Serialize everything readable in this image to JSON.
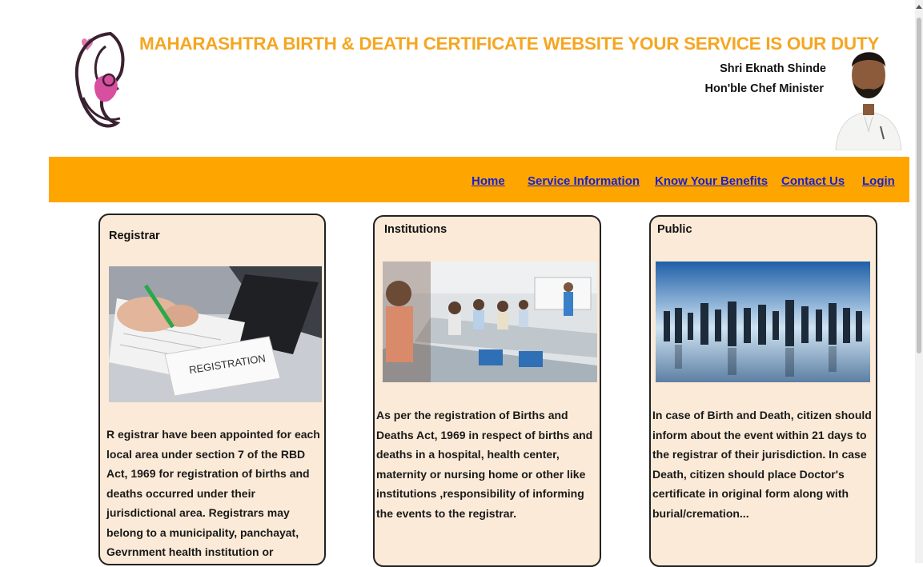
{
  "header": {
    "title": "MAHARASHTRA BIRTH & DEATH CERTIFICATE WEBSITE YOUR SERVICE IS OUR DUTY",
    "minister_name": "Shri Eknath Shinde",
    "minister_role": "Hon'ble Chef Minister",
    "logo_icon": "mother-and-child-logo",
    "photo_icon": "minister-portrait"
  },
  "nav": {
    "home": "Home",
    "service_information": "Service Information",
    "know_your_benefits": "Know Your Benefits",
    "contact_us": "Contact Us",
    "login": "Login"
  },
  "cards": {
    "registrar": {
      "title": "Registrar",
      "image_text": "REGISTRATION",
      "text": " R egistrar have been appointed for each local area under section 7 of the RBD Act, 1969 for registration of births and deaths occurred under their jurisdictional area. Registrars may belong to a municipality, panchayat, Gevrnment health institution or"
    },
    "institutions": {
      "title": "Institutions",
      "text": " As per the registration of Births and Deaths Act, 1969 in   respect of births and deaths in a hospital, health center,     maternity or nursing home or other like institutions ,responsibility of informing the events to the registrar."
    },
    "public": {
      "title": "Public",
      "text": "In case of Birth and Death, citizen should inform about the event within 21 days to the registrar of their jurisdiction. In case Death, citizen should place Doctor's certificate in original form along with burial/cremation..."
    }
  },
  "colors": {
    "accent": "#f5a623",
    "navbar": "#ffa500",
    "link": "#1a22c8",
    "card_bg": "#fbead7"
  }
}
